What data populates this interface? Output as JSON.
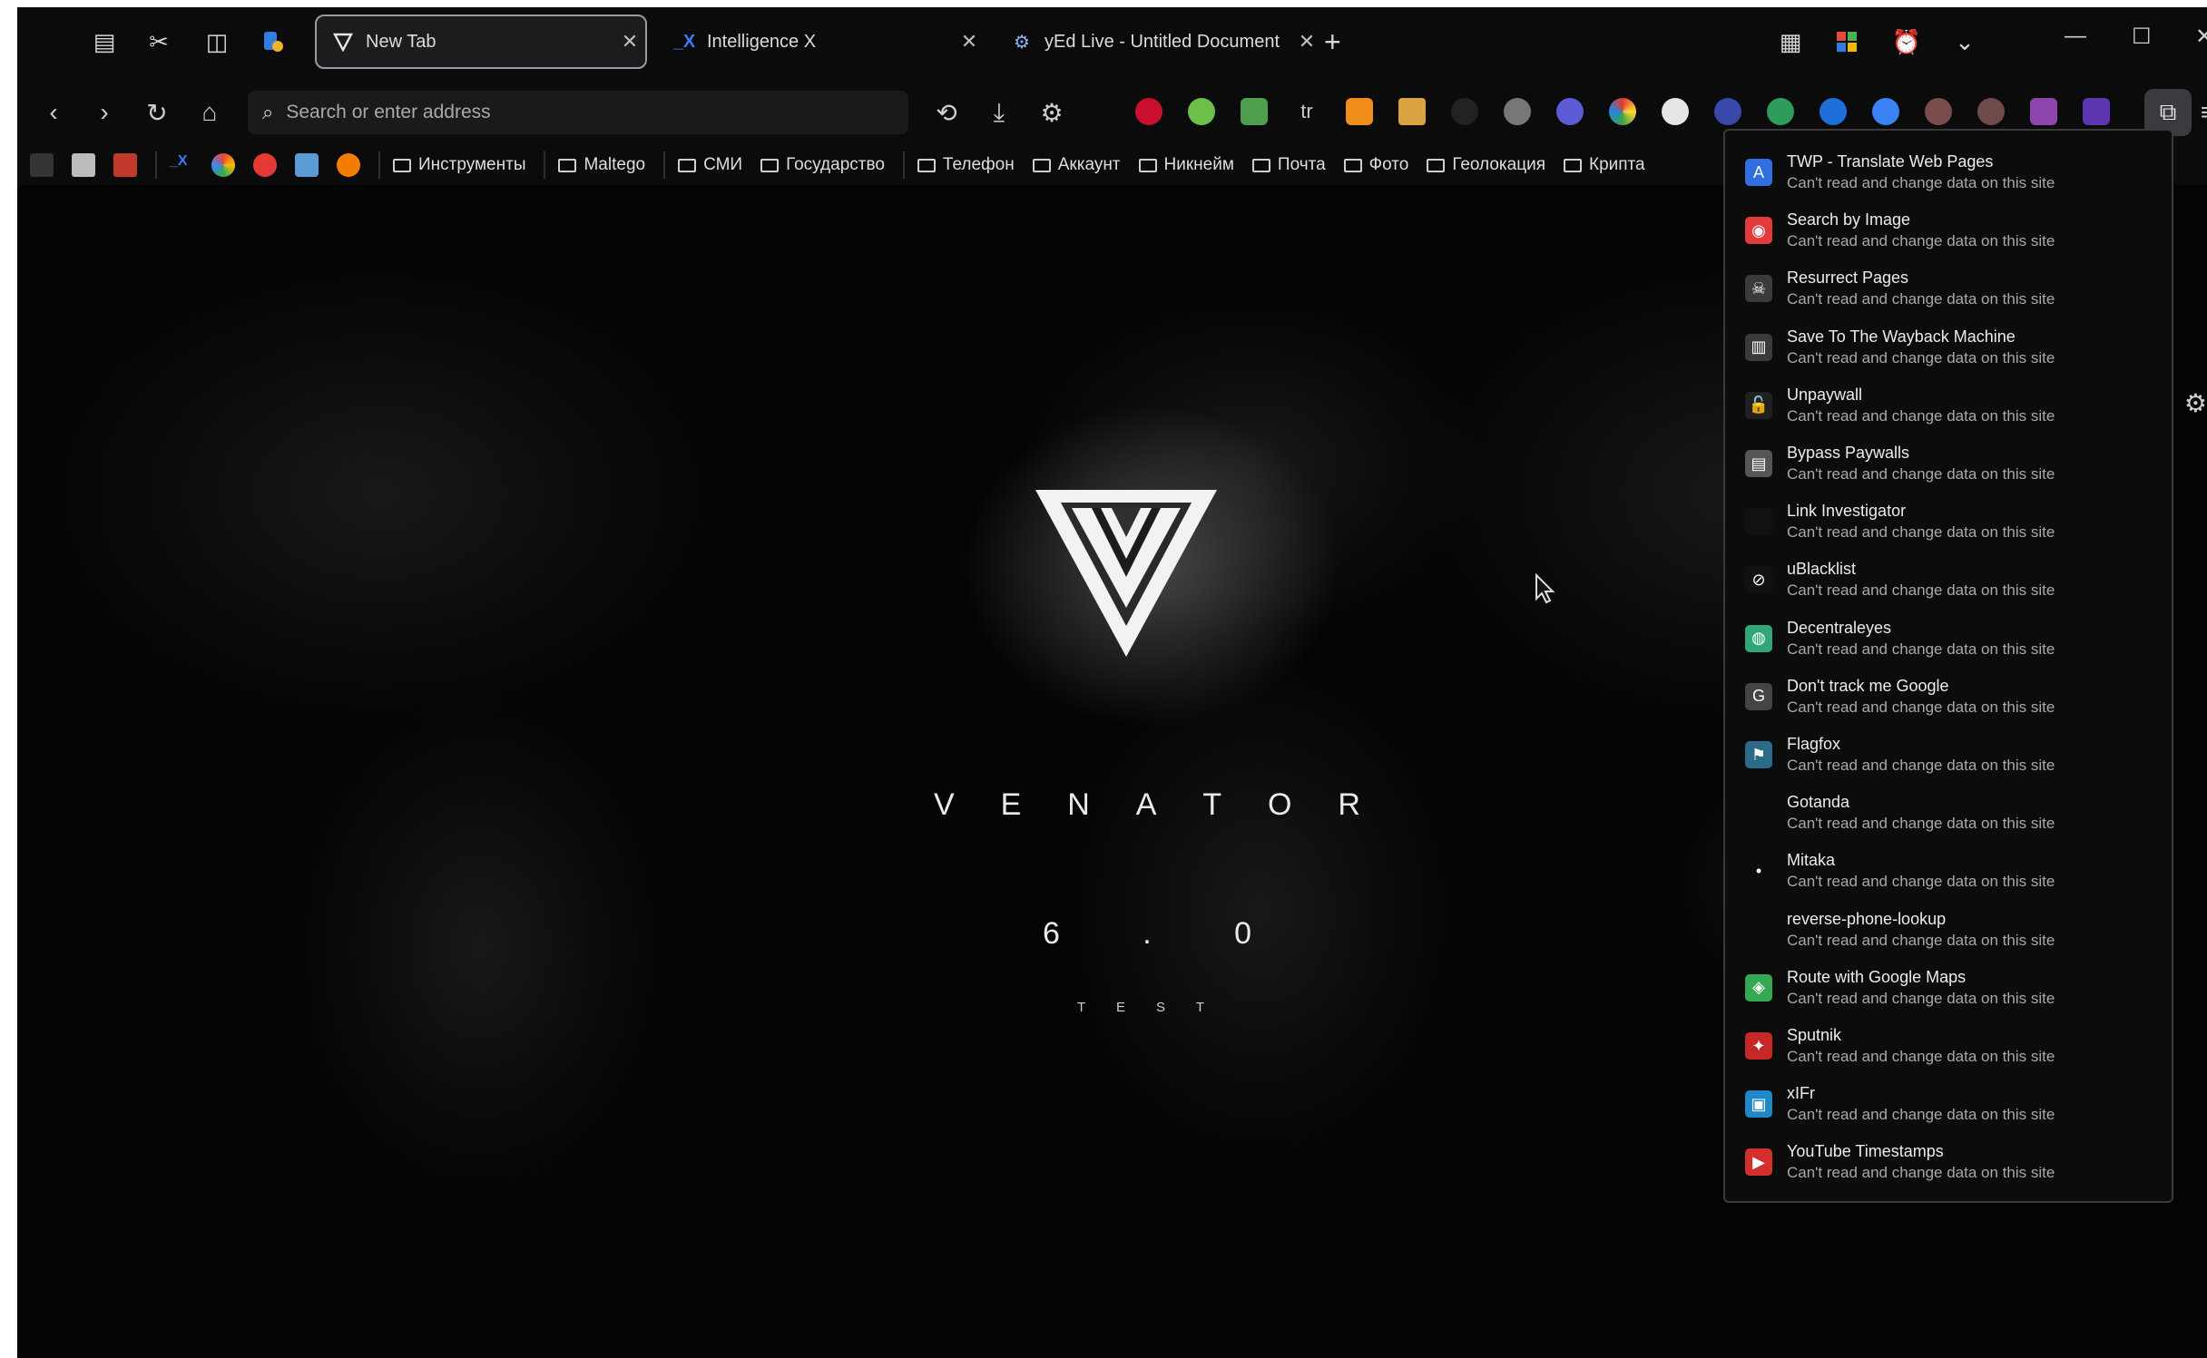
{
  "tabs": [
    {
      "title": "New Tab",
      "favicon": "venator-v-icon",
      "active": true
    },
    {
      "title": "Intelligence X",
      "favicon": "intelx-icon",
      "active": false
    },
    {
      "title": "yEd Live - Untitled Document",
      "favicon": "yed-icon",
      "active": false
    }
  ],
  "address_bar": {
    "placeholder": "Search or enter address",
    "value": ""
  },
  "bookmarks": {
    "folders": [
      "Инструменты",
      "Maltego",
      "СМИ",
      "Государство",
      "Телефон",
      "Аккаунт",
      "Никнейм",
      "Почта",
      "Фото",
      "Геолокация",
      "Крипта"
    ]
  },
  "hero": {
    "brand_letters": [
      "V",
      "E",
      "N",
      "A",
      "T",
      "O",
      "R"
    ],
    "version_chars": [
      "6",
      ".",
      "0"
    ],
    "sub_letters": [
      "T",
      "E",
      "S",
      "T"
    ]
  },
  "extensions_panel": {
    "items": [
      {
        "name": "TWP - Translate Web Pages",
        "permission": "Can't read and change data on this site",
        "icon": "translate-icon",
        "color": "#2f6fe0"
      },
      {
        "name": "Search by Image",
        "permission": "Can't read and change data on this site",
        "icon": "camera-icon",
        "color": "#e23b3b"
      },
      {
        "name": "Resurrect Pages",
        "permission": "Can't read and change data on this site",
        "icon": "zombie-icon",
        "color": "#3a3a3a"
      },
      {
        "name": "Save To The Wayback Machine",
        "permission": "Can't read and change data on this site",
        "icon": "archive-icon",
        "color": "#3a3a3a"
      },
      {
        "name": "Unpaywall",
        "permission": "Can't read and change data on this site",
        "icon": "unlock-icon",
        "color": "#202020"
      },
      {
        "name": "Bypass Paywalls",
        "permission": "Can't read and change data on this site",
        "icon": "newspaper-icon",
        "color": "#555555"
      },
      {
        "name": "Link Investigator",
        "permission": "Can't read and change data on this site",
        "icon": "link-icon",
        "color": "#111111"
      },
      {
        "name": "uBlacklist",
        "permission": "Can't read and change data on this site",
        "icon": "block-icon",
        "color": "#111111"
      },
      {
        "name": "Decentraleyes",
        "permission": "Can't read and change data on this site",
        "icon": "globe-icon",
        "color": "#2fa77a"
      },
      {
        "name": "Don't track me Google",
        "permission": "Can't read and change data on this site",
        "icon": "google-g-icon",
        "color": "#444444"
      },
      {
        "name": "Flagfox",
        "permission": "Can't read and change data on this site",
        "icon": "flag-icon",
        "color": "#2a6b8a"
      },
      {
        "name": "Gotanda",
        "permission": "Can't read and change data on this site",
        "icon": "blank-icon",
        "color": "#0c0c0d"
      },
      {
        "name": "Mitaka",
        "permission": "Can't read and change data on this site",
        "icon": "dot-icon",
        "color": "#0c0c0d"
      },
      {
        "name": "reverse-phone-lookup",
        "permission": "Can't read and change data on this site",
        "icon": "phone-icon",
        "color": "#0c0c0d"
      },
      {
        "name": "Route with Google Maps",
        "permission": "Can't read and change data on this site",
        "icon": "map-icon",
        "color": "#34a853"
      },
      {
        "name": "Sputnik",
        "permission": "Can't read and change data on this site",
        "icon": "satellite-icon",
        "color": "#c62828"
      },
      {
        "name": "xIFr",
        "permission": "Can't read and change data on this site",
        "icon": "photo-icon",
        "color": "#1e88c8"
      },
      {
        "name": "YouTube Timestamps",
        "permission": "Can't read and change data on this site",
        "icon": "youtube-icon",
        "color": "#d32f2f"
      }
    ]
  }
}
